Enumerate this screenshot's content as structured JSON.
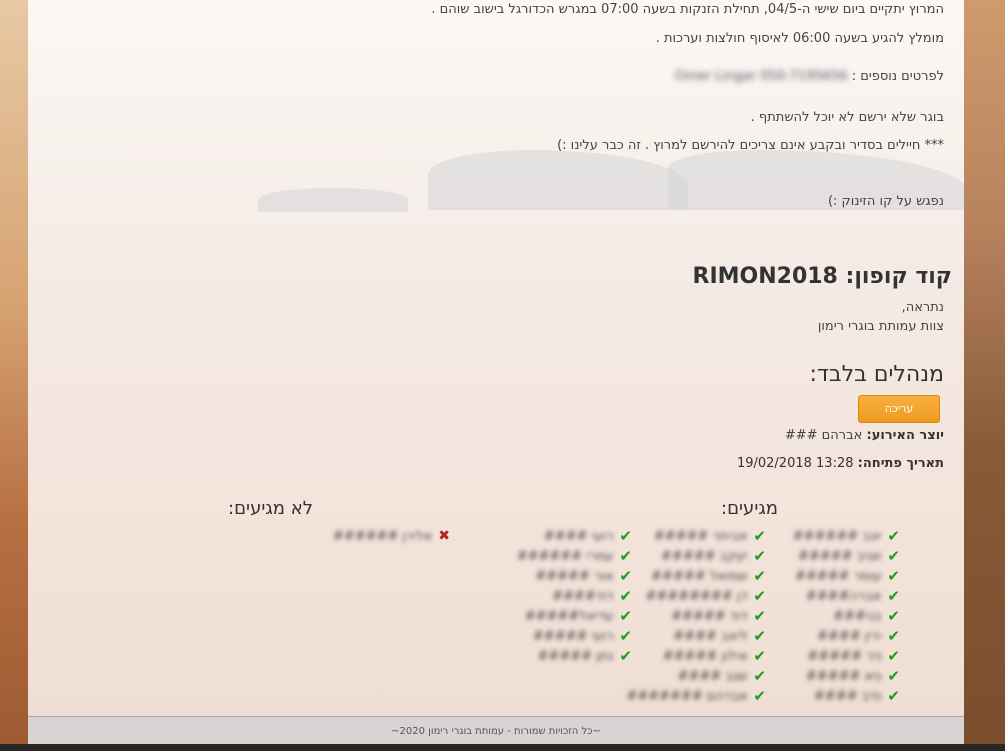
{
  "page": {
    "line1": "המרוץ יתקיים ביום שישי ה-04/5, תחילת הזנקות בשעה 07:00 במגרש הכדורגל בישוב שוהם .",
    "line2": "מומלץ להגיע בשעה 06:00 לאיסוף חולצות וערכות .",
    "details_label": "לפרטים נוספים :",
    "details_value": "Omer Lingar 050-7195656",
    "line4": "בוגר שלא ירשם לא יוכל להשתתף .",
    "line5": "*** חיילים בסדיר ובקבע אינם צריכים להירשם למרוץ . זה כבר עלינו :)",
    "line6": "נפגש על קו הזינוק :)",
    "coupon": "קוד קופון: RIMON2018",
    "sig1": "נתראה,",
    "sig2": "צוות עמותת בוגרי רימון"
  },
  "managers": {
    "title": "מנהלים בלבד:",
    "edit_label": "עריכה",
    "creator_label": "יוצר האירוע:",
    "creator_value": "אברהם ###",
    "opened_label": "תאריך פתיחה:",
    "opened_value": "13:28 19/02/2018"
  },
  "attendees": {
    "arriving_title": "מגיעים:",
    "not_arriving_title": "לא מגיעים:",
    "col1": [
      "יונב ######",
      "שניב #####",
      "עומר #####",
      "אברה####",
      "בני###",
      "ירין ####",
      "ניר #####",
      "גיא #####",
      "נדב ####"
    ],
    "col2": [
      "אביתר #####",
      "יעקב #####",
      "שמואל #####",
      "דן ########",
      "דוד #####",
      "ליאב ####",
      "אילון #####",
      "שגב ####",
      "אברהם #######"
    ],
    "col3": [
      "רועי ####",
      "עמרי ######",
      "אור #####",
      "דוד####",
      "עדיאל#####",
      "רועי #####",
      "נתן #####"
    ],
    "not_arriving": [
      "אלירן ######"
    ]
  },
  "footer": {
    "text": "~כל הזכויות שמורות - עמותת בוגרי רימון 2020~"
  }
}
